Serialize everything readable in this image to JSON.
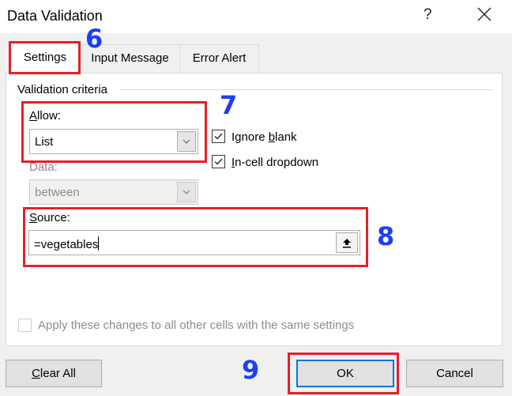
{
  "window": {
    "title": "Data Validation",
    "help_label": "?",
    "close_icon": "close-icon"
  },
  "tabs": [
    {
      "label": "Settings",
      "active": true
    },
    {
      "label": "Input Message",
      "active": false
    },
    {
      "label": "Error Alert",
      "active": false
    }
  ],
  "settings": {
    "group_label": "Validation criteria",
    "allow": {
      "label_accel": "A",
      "label_rest": "llow:",
      "value": "List"
    },
    "data": {
      "label": "Data:",
      "value": "between",
      "disabled": true
    },
    "ignore_blank": {
      "label_pre": "Ignore ",
      "label_accel": "b",
      "label_rest": "lank",
      "checked": true
    },
    "in_cell_dropdown": {
      "label_accel": "I",
      "label_rest": "n-cell dropdown",
      "checked": true
    },
    "source": {
      "label_accel": "S",
      "label_rest": "ource:",
      "value": "=vegetables",
      "collapse_icon": "collapse-dialog-arrow-up-icon"
    },
    "apply_all": {
      "label": "Apply these changes to all other cells with the same settings",
      "checked": false,
      "disabled": true
    }
  },
  "buttons": {
    "clear_all_accel": "C",
    "clear_all_rest": "lear All",
    "ok": "OK",
    "cancel": "Cancel"
  },
  "annotations": [
    {
      "number": "6",
      "target": "Settings tab"
    },
    {
      "number": "7",
      "target": "Allow dropdown"
    },
    {
      "number": "8",
      "target": "Source field"
    },
    {
      "number": "9",
      "target": "OK button"
    }
  ],
  "colors": {
    "annotation_box": "#e5202a",
    "annotation_number": "#1f3ff2",
    "default_button_border": "#0078d7"
  }
}
